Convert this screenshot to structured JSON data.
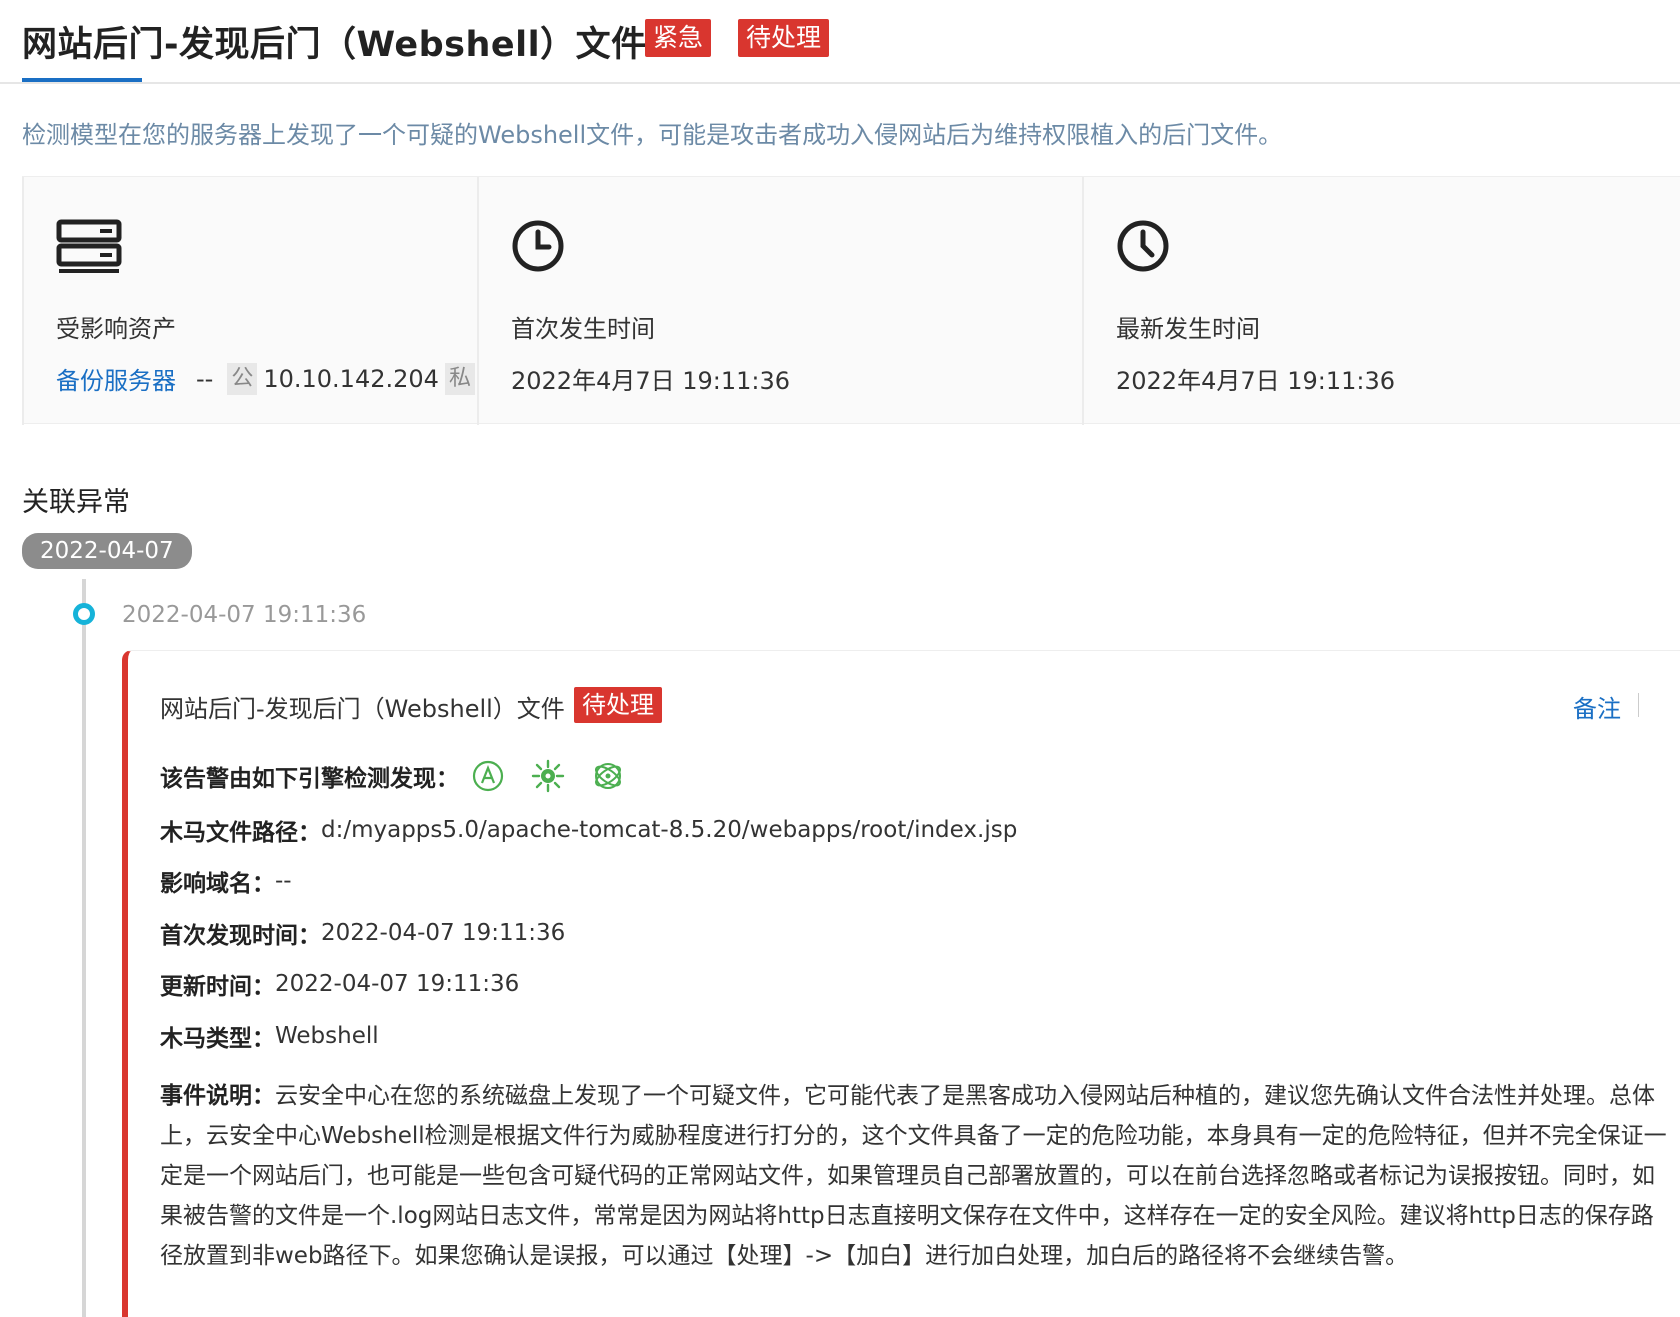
{
  "header": {
    "title": "网站后门-发现后门（Webshell）文件",
    "tag_urgent": "紧急",
    "tag_pending": "待处理"
  },
  "description": "检测模型在您的服务器上发现了一个可疑的Webshell文件，可能是攻击者成功入侵网站后为维持权限植入的后门文件。",
  "cards": {
    "asset": {
      "label": "受影响资产",
      "name": "备份服务器",
      "separator": "--",
      "public_badge": "公",
      "ip": "10.10.142.204",
      "private_badge": "私"
    },
    "first_time": {
      "label": "首次发生时间",
      "value": "2022年4月7日 19:11:36"
    },
    "latest_time": {
      "label": "最新发生时间",
      "value": "2022年4月7日 19:11:36"
    }
  },
  "related": {
    "section_title": "关联异常",
    "date_pill": "2022-04-07",
    "event_time": "2022-04-07 19:11:36",
    "event": {
      "title": "网站后门-发现后门（Webshell）文件",
      "tag": "待处理",
      "note_label": "备注",
      "engines_label": "该告警由如下引擎检测发现：",
      "engines": [
        "engine-a-icon",
        "engine-virus-icon",
        "engine-atom-icon"
      ],
      "fields": {
        "path_label": "木马文件路径：",
        "path_value": "d:/myapps5.0/apache-tomcat-8.5.20/webapps/root/index.jsp",
        "domain_label": "影响域名：",
        "domain_value": "--",
        "first_found_label": "首次发现时间：",
        "first_found_value": "2022-04-07 19:11:36",
        "update_label": "更新时间：",
        "update_value": "2022-04-07 19:11:36",
        "type_label": "木马类型：",
        "type_value": "Webshell",
        "desc_label": "事件说明：",
        "desc_value": "云安全中心在您的系统磁盘上发现了一个可疑文件，它可能代表了是黑客成功入侵网站后种植的，建议您先确认文件合法性并处理。总体上，云安全中心Webshell检测是根据文件行为威胁程度进行打分的，这个文件具备了一定的危险功能，本身具有一定的危险特征，但并不完全保证一定是一个网站后门，也可能是一些包含可疑代码的正常网站文件，如果管理员自己部署放置的，可以在前台选择忽略或者标记为误报按钮。同时，如果被告警的文件是一个.log网站日志文件，常常是因为网站将http日志直接明文保存在文件中，这样存在一定的安全风险。建议将http日志的保存路径放置到非web路径下。如果您确认是误报，可以通过【处理】->【加白】进行加白处理，加白后的路径将不会继续告警。"
      }
    }
  },
  "colors": {
    "danger": "#d9362f",
    "link": "#1a6fc4",
    "timeline_dot": "#16b3d9",
    "engine_green": "#4caf50"
  }
}
